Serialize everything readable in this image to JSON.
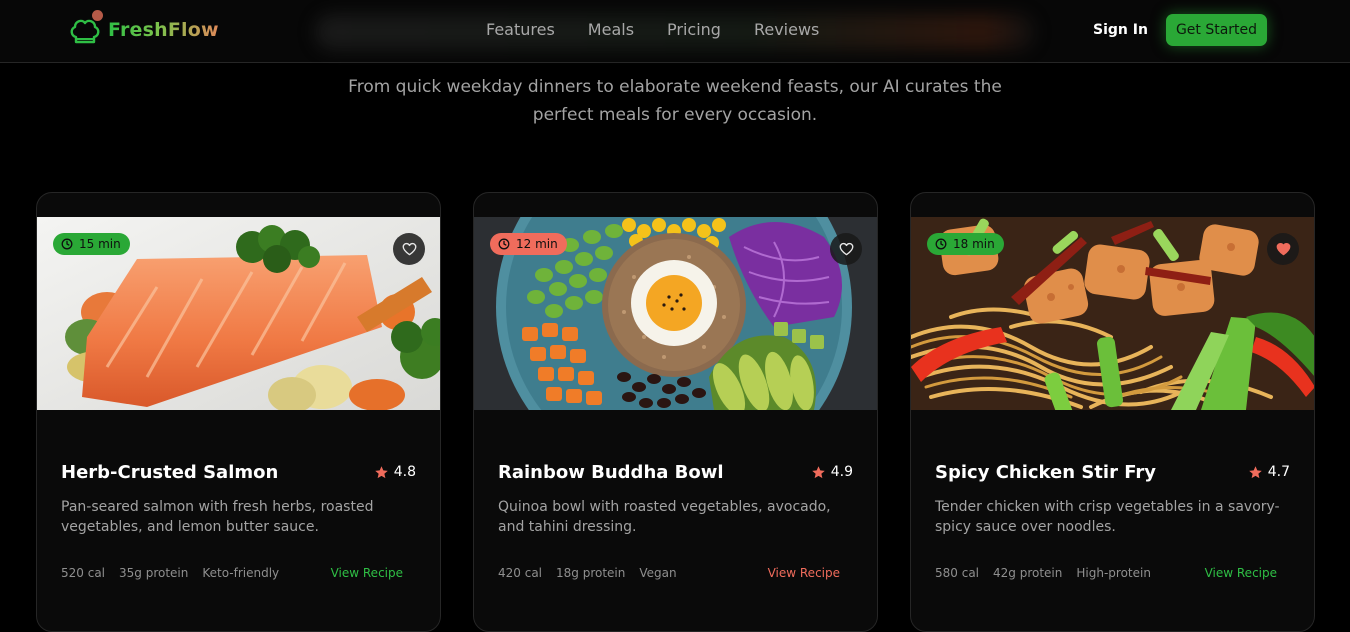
{
  "header": {
    "brand": "FreshFlow",
    "nav": [
      "Features",
      "Meals",
      "Pricing",
      "Reviews"
    ],
    "sign_in": "Sign In",
    "get_started": "Get Started"
  },
  "hero": {
    "subtitle": "From quick weekday dinners to elaborate weekend feasts, our AI curates the perfect meals for every occasion."
  },
  "colors": {
    "brand_green": "#2aa836",
    "accent_coral": "#f06c5c",
    "background": "#000000",
    "card": "#0a0a0a"
  },
  "meals": [
    {
      "time": "15 min",
      "title": "Herb-Crusted Salmon",
      "rating": "4.8",
      "description": "Pan-seared salmon with fresh herbs, roasted vegetables, and lemon butter sauce.",
      "calories": "520 cal",
      "protein": "35g protein",
      "tag": "Keto-friendly",
      "cta": "View Recipe",
      "accent": "green",
      "favorited": false,
      "image": "salmon-photo"
    },
    {
      "time": "12 min",
      "title": "Rainbow Buddha Bowl",
      "rating": "4.9",
      "description": "Quinoa bowl with roasted vegetables, avocado, and tahini dressing.",
      "calories": "420 cal",
      "protein": "18g protein",
      "tag": "Vegan",
      "cta": "View Recipe",
      "accent": "coral",
      "favorited": false,
      "image": "buddha-bowl-photo"
    },
    {
      "time": "18 min",
      "title": "Spicy Chicken Stir Fry",
      "rating": "4.7",
      "description": "Tender chicken with crisp vegetables in a savory-spicy sauce over noodles.",
      "calories": "580 cal",
      "protein": "42g protein",
      "tag": "High-protein",
      "cta": "View Recipe",
      "accent": "green",
      "favorited": true,
      "image": "stir-fry-photo"
    }
  ]
}
